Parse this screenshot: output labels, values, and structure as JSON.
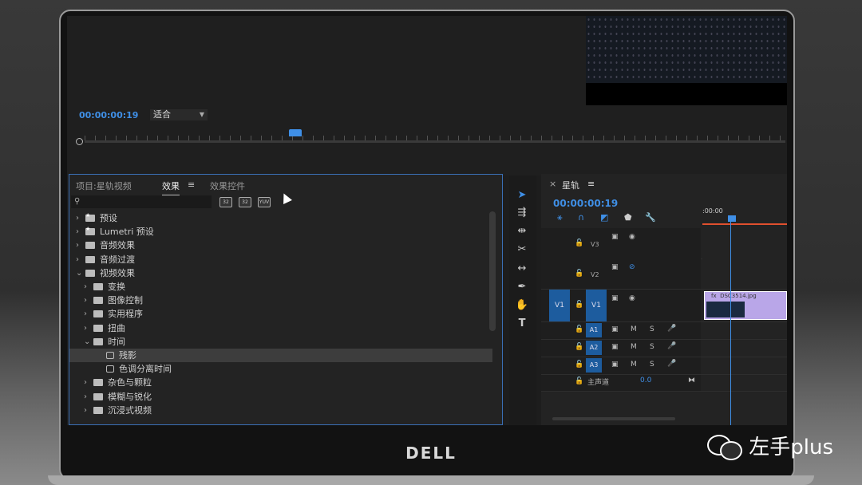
{
  "program_monitor": {
    "timecode": "00:00:00:19",
    "fit_select": "适合"
  },
  "effects_panel": {
    "tabs": [
      {
        "label": "项目:星轨视频"
      },
      {
        "label": "效果"
      },
      {
        "label": "效果控件"
      }
    ],
    "tab_menu_icon": "≡",
    "search_placeholder": "",
    "bin_buttons": [
      "32",
      "32",
      "YUV"
    ],
    "tree": [
      {
        "label": "预设",
        "level": 0,
        "type": "folder-star",
        "expanded": false
      },
      {
        "label": "Lumetri 预设",
        "level": 0,
        "type": "folder-star",
        "expanded": false
      },
      {
        "label": "音频效果",
        "level": 0,
        "type": "folder",
        "expanded": false
      },
      {
        "label": "音频过渡",
        "level": 0,
        "type": "folder",
        "expanded": false
      },
      {
        "label": "视频效果",
        "level": 0,
        "type": "folder",
        "expanded": true
      },
      {
        "label": "变换",
        "level": 1,
        "type": "folder",
        "expanded": false
      },
      {
        "label": "图像控制",
        "level": 1,
        "type": "folder",
        "expanded": false
      },
      {
        "label": "实用程序",
        "level": 1,
        "type": "folder",
        "expanded": false
      },
      {
        "label": "扭曲",
        "level": 1,
        "type": "folder",
        "expanded": false
      },
      {
        "label": "时间",
        "level": 1,
        "type": "folder",
        "expanded": true
      },
      {
        "label": "残影",
        "level": 2,
        "type": "effect",
        "selected": true
      },
      {
        "label": "色调分离时间",
        "level": 2,
        "type": "effect"
      },
      {
        "label": "杂色与颗粒",
        "level": 1,
        "type": "folder",
        "expanded": false
      },
      {
        "label": "模糊与锐化",
        "level": 1,
        "type": "folder",
        "expanded": false
      },
      {
        "label": "沉浸式视频",
        "level": 1,
        "type": "folder",
        "expanded": false
      }
    ]
  },
  "tools": [
    "selection-tool",
    "track-select-tool",
    "ripple-edit-tool",
    "razor-tool",
    "slip-tool",
    "pen-tool",
    "hand-tool",
    "type-tool"
  ],
  "timeline": {
    "sequence_name": "星轨",
    "close_icon": "×",
    "menu_icon": "≡",
    "timecode": "00:00:00:19",
    "ruler_time": ":00:00",
    "tracks": [
      {
        "name": "V3",
        "kind": "video"
      },
      {
        "name": "V2",
        "kind": "video"
      },
      {
        "name": "V1",
        "kind": "video",
        "source": "V1"
      },
      {
        "name": "A1",
        "kind": "audio"
      },
      {
        "name": "A2",
        "kind": "audio"
      },
      {
        "name": "A3",
        "kind": "audio"
      }
    ],
    "clip_label": "DSC3514.jpg",
    "clip_fx": "fx",
    "master_label": "主声道",
    "master_value": "0.0",
    "mute_label": "M",
    "solo_label": "S"
  },
  "brand": "DELL",
  "watermark": "左手plus"
}
